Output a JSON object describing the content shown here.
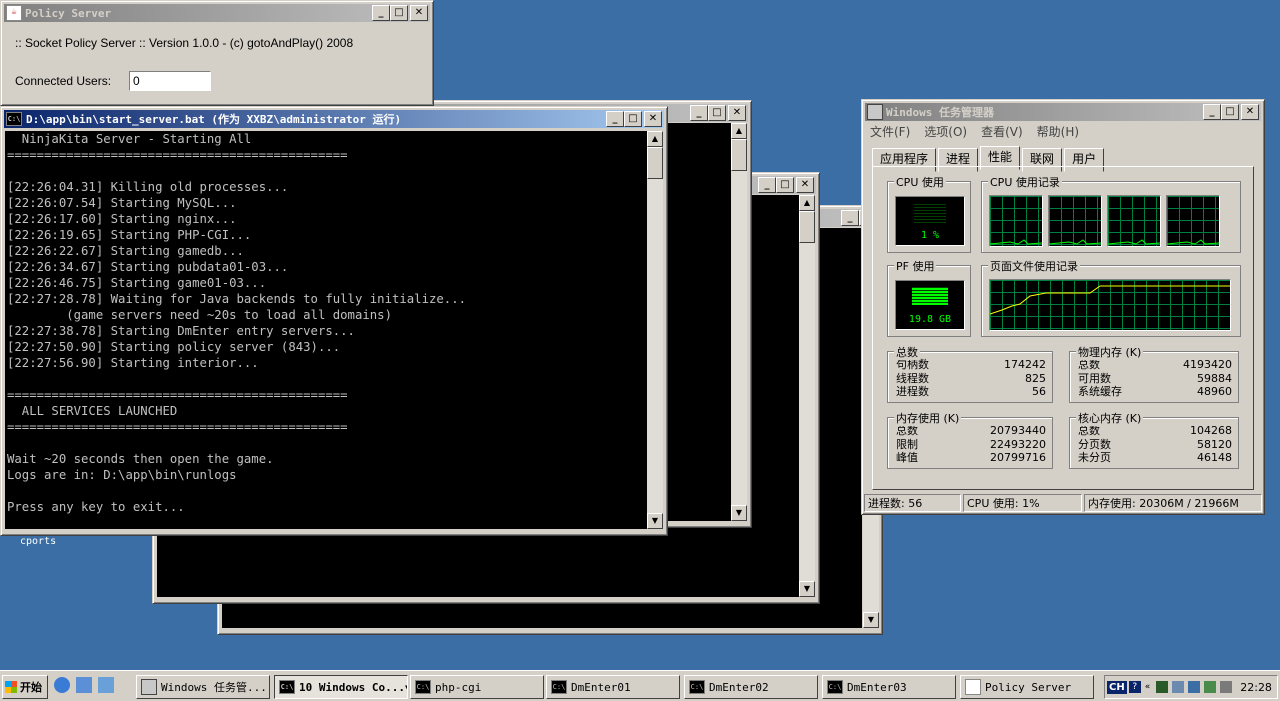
{
  "policy_window": {
    "title": "Policy Server",
    "header": ":: Socket Policy Server :: Version 1.0.0 - (c) gotoAndPlay() 2008",
    "users_label": "Connected Users:",
    "users_value": "0"
  },
  "main_console": {
    "title": "D:\\app\\bin\\start_server.bat (作为 XXBZ\\administrator 运行)",
    "lines": [
      "  NinjaKita Server - Starting All",
      "==============================================",
      "",
      "[22:26:04.31] Killing old processes...",
      "[22:26:07.54] Starting MySQL...",
      "[22:26:17.60] Starting nginx...",
      "[22:26:19.65] Starting PHP-CGI...",
      "[22:26:22.67] Starting gamedb...",
      "[22:26:34.67] Starting pubdata01-03...",
      "[22:26:46.75] Starting game01-03...",
      "[22:27:28.78] Waiting for Java backends to fully initialize...",
      "        (game servers need ~20s to load all domains)",
      "[22:27:38.78] Starting DmEnter entry servers...",
      "[22:27:50.90] Starting policy server (843)...",
      "[22:27:56.90] Starting interior...",
      "",
      "==============================================",
      "  ALL SERVICES LAUNCHED",
      "==============================================",
      "",
      "Wait ~20 seconds then open the game.",
      "Logs are in: D:\\app\\bin\\runlogs",
      "",
      "Press any key to exit..."
    ]
  },
  "desktop_icon_label": "cports",
  "taskmgr": {
    "title": "Windows 任务管理器",
    "menu": [
      "文件(F)",
      "选项(O)",
      "查看(V)",
      "帮助(H)"
    ],
    "tabs": [
      "应用程序",
      "进程",
      "性能",
      "联网",
      "用户"
    ],
    "active_tab": "性能",
    "cpu_usage_title": "CPU 使用",
    "cpu_usage_value": "1 %",
    "cpu_history_title": "CPU 使用记录",
    "pf_usage_title": "PF 使用",
    "pf_usage_value": "19.8 GB",
    "pf_history_title": "页面文件使用记录",
    "totals": {
      "title": "总数",
      "rows": [
        {
          "label": "句柄数",
          "value": "174242"
        },
        {
          "label": "线程数",
          "value": "825"
        },
        {
          "label": "进程数",
          "value": "56"
        }
      ]
    },
    "physical": {
      "title": "物理内存 (K)",
      "rows": [
        {
          "label": "总数",
          "value": "4193420"
        },
        {
          "label": "可用数",
          "value": "59884"
        },
        {
          "label": "系统缓存",
          "value": "48960"
        }
      ]
    },
    "commit": {
      "title": "内存使用 (K)",
      "rows": [
        {
          "label": "总数",
          "value": "20793440"
        },
        {
          "label": "限制",
          "value": "22493220"
        },
        {
          "label": "峰值",
          "value": "20799716"
        }
      ]
    },
    "kernel": {
      "title": "核心内存 (K)",
      "rows": [
        {
          "label": "总数",
          "value": "104268"
        },
        {
          "label": "分页数",
          "value": "58120"
        },
        {
          "label": "未分页",
          "value": "46148"
        }
      ]
    },
    "status": {
      "processes": "进程数: 56",
      "cpu": "CPU 使用: 1%",
      "memory": "内存使用: 20306M / 21966M"
    }
  },
  "taskbar": {
    "start_label": "开始",
    "tasks": [
      {
        "label": "Windows 任务管...",
        "icon": "taskmgr-icon"
      },
      {
        "label": "10 Windows Co...",
        "icon": "cmd-icon",
        "pressed": true
      },
      {
        "label": "php-cgi",
        "icon": "cmd-icon"
      },
      {
        "label": "DmEnter01",
        "icon": "cmd-icon"
      },
      {
        "label": "DmEnter02",
        "icon": "cmd-icon"
      },
      {
        "label": "DmEnter03",
        "icon": "cmd-icon"
      },
      {
        "label": "Policy Server",
        "icon": "java-icon"
      }
    ],
    "lang": "CH",
    "clock": "22:28"
  }
}
